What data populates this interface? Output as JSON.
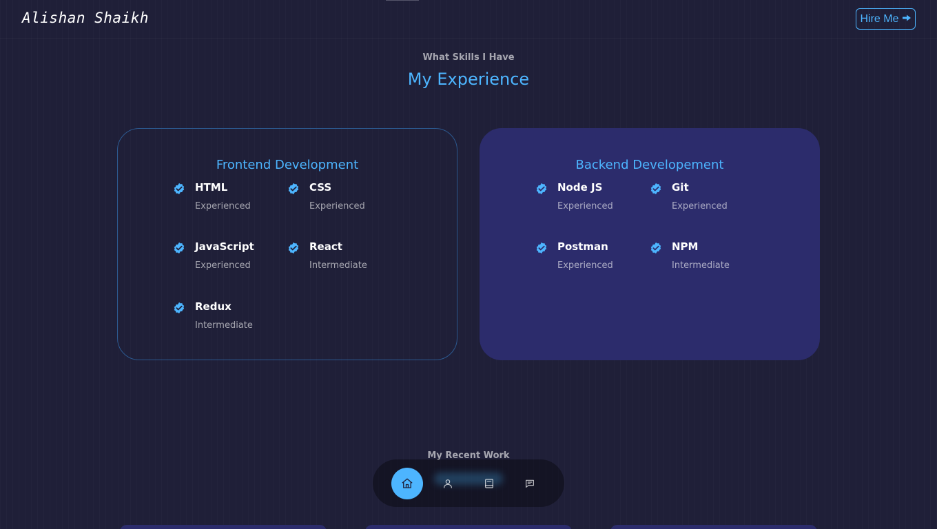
{
  "header": {
    "logo": "Alishan Shaikh",
    "hire_label": "Hire Me",
    "hire_icon": "arrow-right-icon"
  },
  "experience": {
    "subtitle": "What Skills I Have",
    "title": "My Experience",
    "frontend": {
      "title": "Frontend Development",
      "skills": [
        {
          "name": "HTML",
          "level": "Experienced"
        },
        {
          "name": "CSS",
          "level": "Experienced"
        },
        {
          "name": "JavaScript",
          "level": "Experienced"
        },
        {
          "name": "React",
          "level": "Intermediate"
        },
        {
          "name": "Redux",
          "level": "Intermediate"
        }
      ]
    },
    "backend": {
      "title": "Backend Developement",
      "skills": [
        {
          "name": "Node JS",
          "level": "Experienced"
        },
        {
          "name": "Git",
          "level": "Experienced"
        },
        {
          "name": "Postman",
          "level": "Experienced"
        },
        {
          "name": "NPM",
          "level": "Intermediate"
        }
      ]
    }
  },
  "portfolio": {
    "subtitle": "My Recent Work"
  },
  "nav": {
    "items": [
      {
        "icon": "home-icon",
        "active": true
      },
      {
        "icon": "user-icon",
        "active": false
      },
      {
        "icon": "book-icon",
        "active": false
      },
      {
        "icon": "message-icon",
        "active": false
      }
    ]
  },
  "colors": {
    "background": "#1f1f38",
    "accent": "#4db5ff",
    "card_variant": "#2c2c6c"
  }
}
